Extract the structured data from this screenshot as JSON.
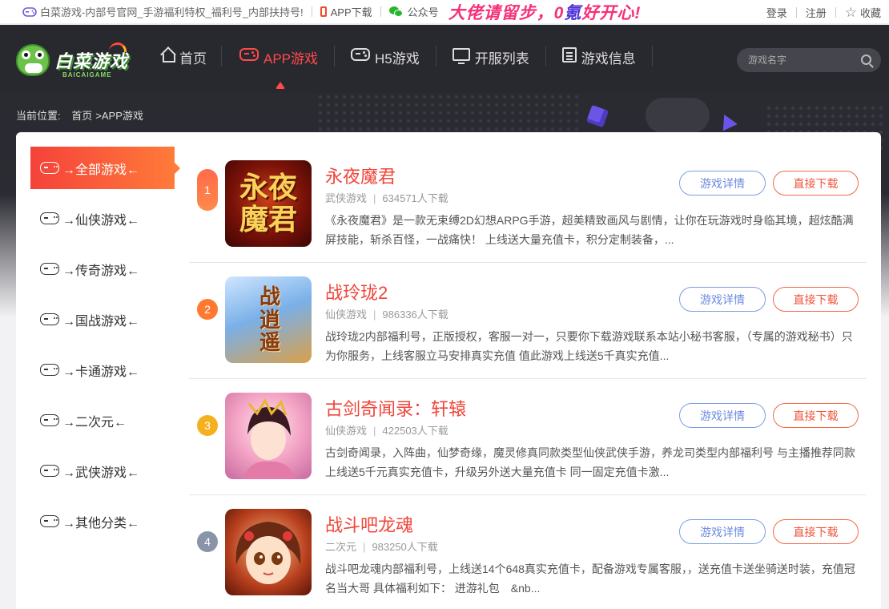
{
  "topbar": {
    "site_name": "白菜游戏-内部号官网_手游福利特权_福利号_内部扶持号!",
    "app_download": "APP下载",
    "wechat": "公众号",
    "promo_a": "大佬请留步，",
    "promo_zero": "0",
    "promo_kr": "氪",
    "promo_b": "好开心!",
    "login": "登录",
    "register": "注册",
    "favorite": "收藏"
  },
  "header": {
    "logo_text": "白菜游戏",
    "logo_sub": "BAICAIGAME",
    "nav": [
      {
        "label": "首页",
        "icon": "home-icon"
      },
      {
        "label": "APP游戏",
        "icon": "gamepad-icon"
      },
      {
        "label": "H5游戏",
        "icon": "gamepad-icon"
      },
      {
        "label": "开服列表",
        "icon": "monitor-icon"
      },
      {
        "label": "游戏信息",
        "icon": "document-icon"
      }
    ],
    "search_placeholder": "游戏名字"
  },
  "breadcrumb": {
    "label": "当前位置:",
    "home": "首页",
    "current": ">APP游戏"
  },
  "sidebar": {
    "items": [
      {
        "label": "→全部游戏←"
      },
      {
        "label": "→仙侠游戏←"
      },
      {
        "label": "→传奇游戏←"
      },
      {
        "label": "→国战游戏←"
      },
      {
        "label": "→卡通游戏←"
      },
      {
        "label": "→二次元←"
      },
      {
        "label": "→武侠游戏←"
      },
      {
        "label": "→其他分类←"
      }
    ]
  },
  "buttons": {
    "detail": "游戏详情",
    "download": "直接下载"
  },
  "games": [
    {
      "rank": "1",
      "name": "永夜魔君",
      "category": "武侠游戏",
      "downloads": "634571人下载",
      "desc": "《永夜魔君》是一款无束缚2D幻想ARPG手游，超美精致画风与剧情，让你在玩游戏时身临其境，超炫酷满屏技能，斩杀百怪，一战痛快！ 上线送大量充值卡，积分定制装备，...",
      "thumb_text": "永夜魔君",
      "rank_color": "#ff6a4a"
    },
    {
      "rank": "2",
      "name": "战玲珑2",
      "category": "仙侠游戏",
      "downloads": "986336人下载",
      "desc": "战玲珑2内部福利号，正版授权，客服一对一，只要你下载游戏联系本站小秘书客服，（专属的游戏秘书）只为你服务，上线客服立马安排真实充值 值此游戏上线送5千真实充值...",
      "thumb_text": "战逍遥",
      "rank_color": "#ff7a30"
    },
    {
      "rank": "3",
      "name": "古剑奇闻录：轩辕",
      "category": "仙侠游戏",
      "downloads": "422503人下载",
      "desc": "古剑奇闻录，入阵曲，仙梦奇缘，魔灵修真同款类型仙侠武侠手游，养龙司类型内部福利号 与主播推荐同款 上线送5千元真实充值卡，升级另外送大量充值卡 同一固定充值卡激...",
      "thumb_text": "",
      "rank_color": "#f5b020"
    },
    {
      "rank": "4",
      "name": "战斗吧龙魂",
      "category": "二次元",
      "downloads": "983250人下载",
      "desc": "战斗吧龙魂内部福利号，上线送14个648真实充值卡，配备游戏专属客服，，送充值卡送坐骑送时装，充值冠名当大哥 具体福利如下： 进游礼包　&nb...",
      "thumb_text": "",
      "rank_color": "#8a94a8"
    }
  ]
}
